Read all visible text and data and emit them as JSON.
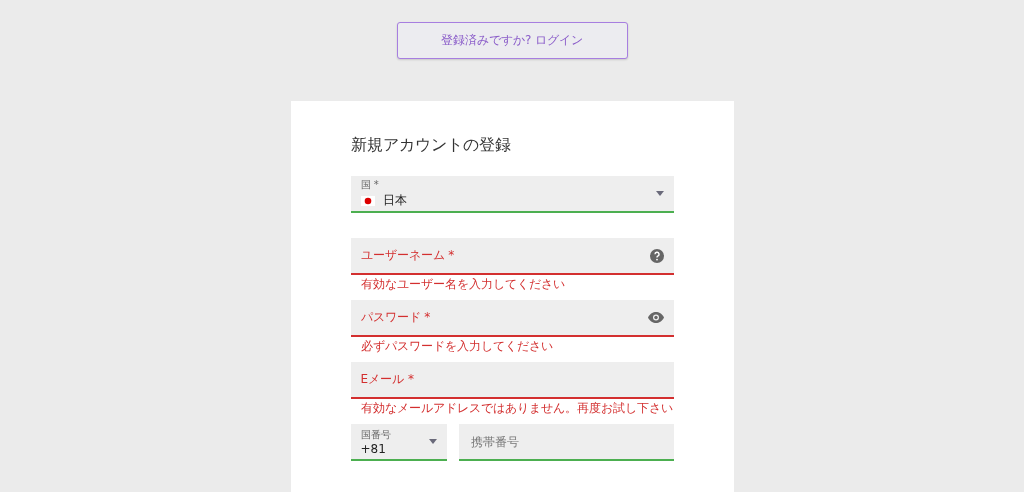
{
  "login_button": {
    "label": "登録済みですか? ログイン"
  },
  "form": {
    "title": "新規アカウントの登録",
    "fields": [
      {
        "kind": "select",
        "label": "国 *",
        "value": "日本",
        "valid": true
      },
      {
        "kind": "help",
        "label": "ユーザーネーム *",
        "error": "有効なユーザー名を入力してください",
        "valid": false
      },
      {
        "kind": "password",
        "label": "パスワード *",
        "error": "必ずパスワードを入力してください",
        "valid": false
      },
      {
        "kind": "text",
        "label": "Eメール *",
        "error": "有効なメールアドレスではありません。再度お試し下さい",
        "valid": false
      },
      {
        "kind": "phone",
        "code_label": "国番号",
        "code_value": "+81",
        "placeholder": "携帯番号",
        "valid": true
      }
    ]
  }
}
